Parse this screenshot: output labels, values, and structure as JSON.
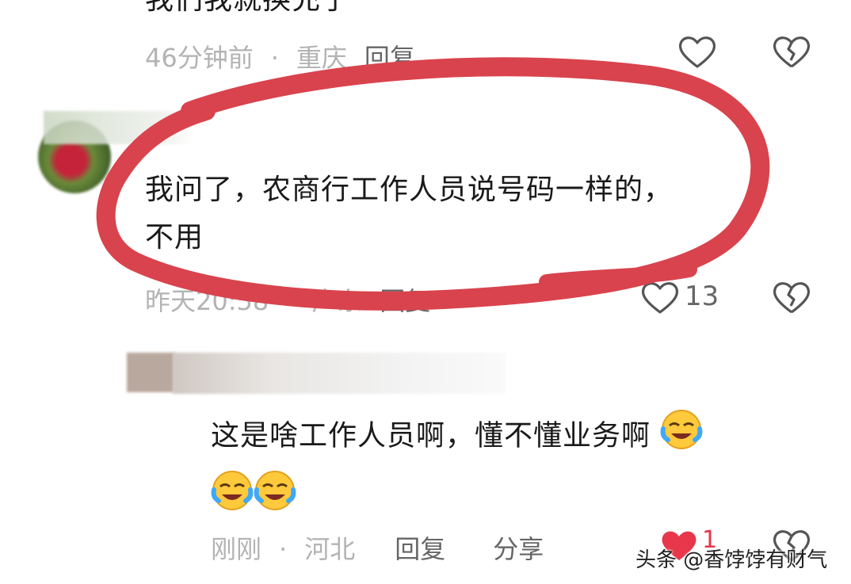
{
  "comments": [
    {
      "text": "我们我就换充了",
      "time": "46分钟前",
      "location": "重庆",
      "reply_label": "回复"
    },
    {
      "text_line1": "我问了，农商行工作人员说号码一样的，",
      "text_line2": "不用",
      "time": "昨天20:58",
      "location": "广东",
      "reply_label": "回复",
      "like_count": "13"
    },
    {
      "text_line1": "这是啥工作人员啊，懂不懂业务啊",
      "time": "刚刚",
      "location": "河北",
      "reply_label": "回复",
      "share_label": "分享",
      "like_count": "1"
    }
  ],
  "separator": "·",
  "watermark": "头条 @香饽饽有财气",
  "colors": {
    "highlight_ring": "#d9434d",
    "meta_gray": "#b3b3b3",
    "like_red": "#e8364a"
  }
}
